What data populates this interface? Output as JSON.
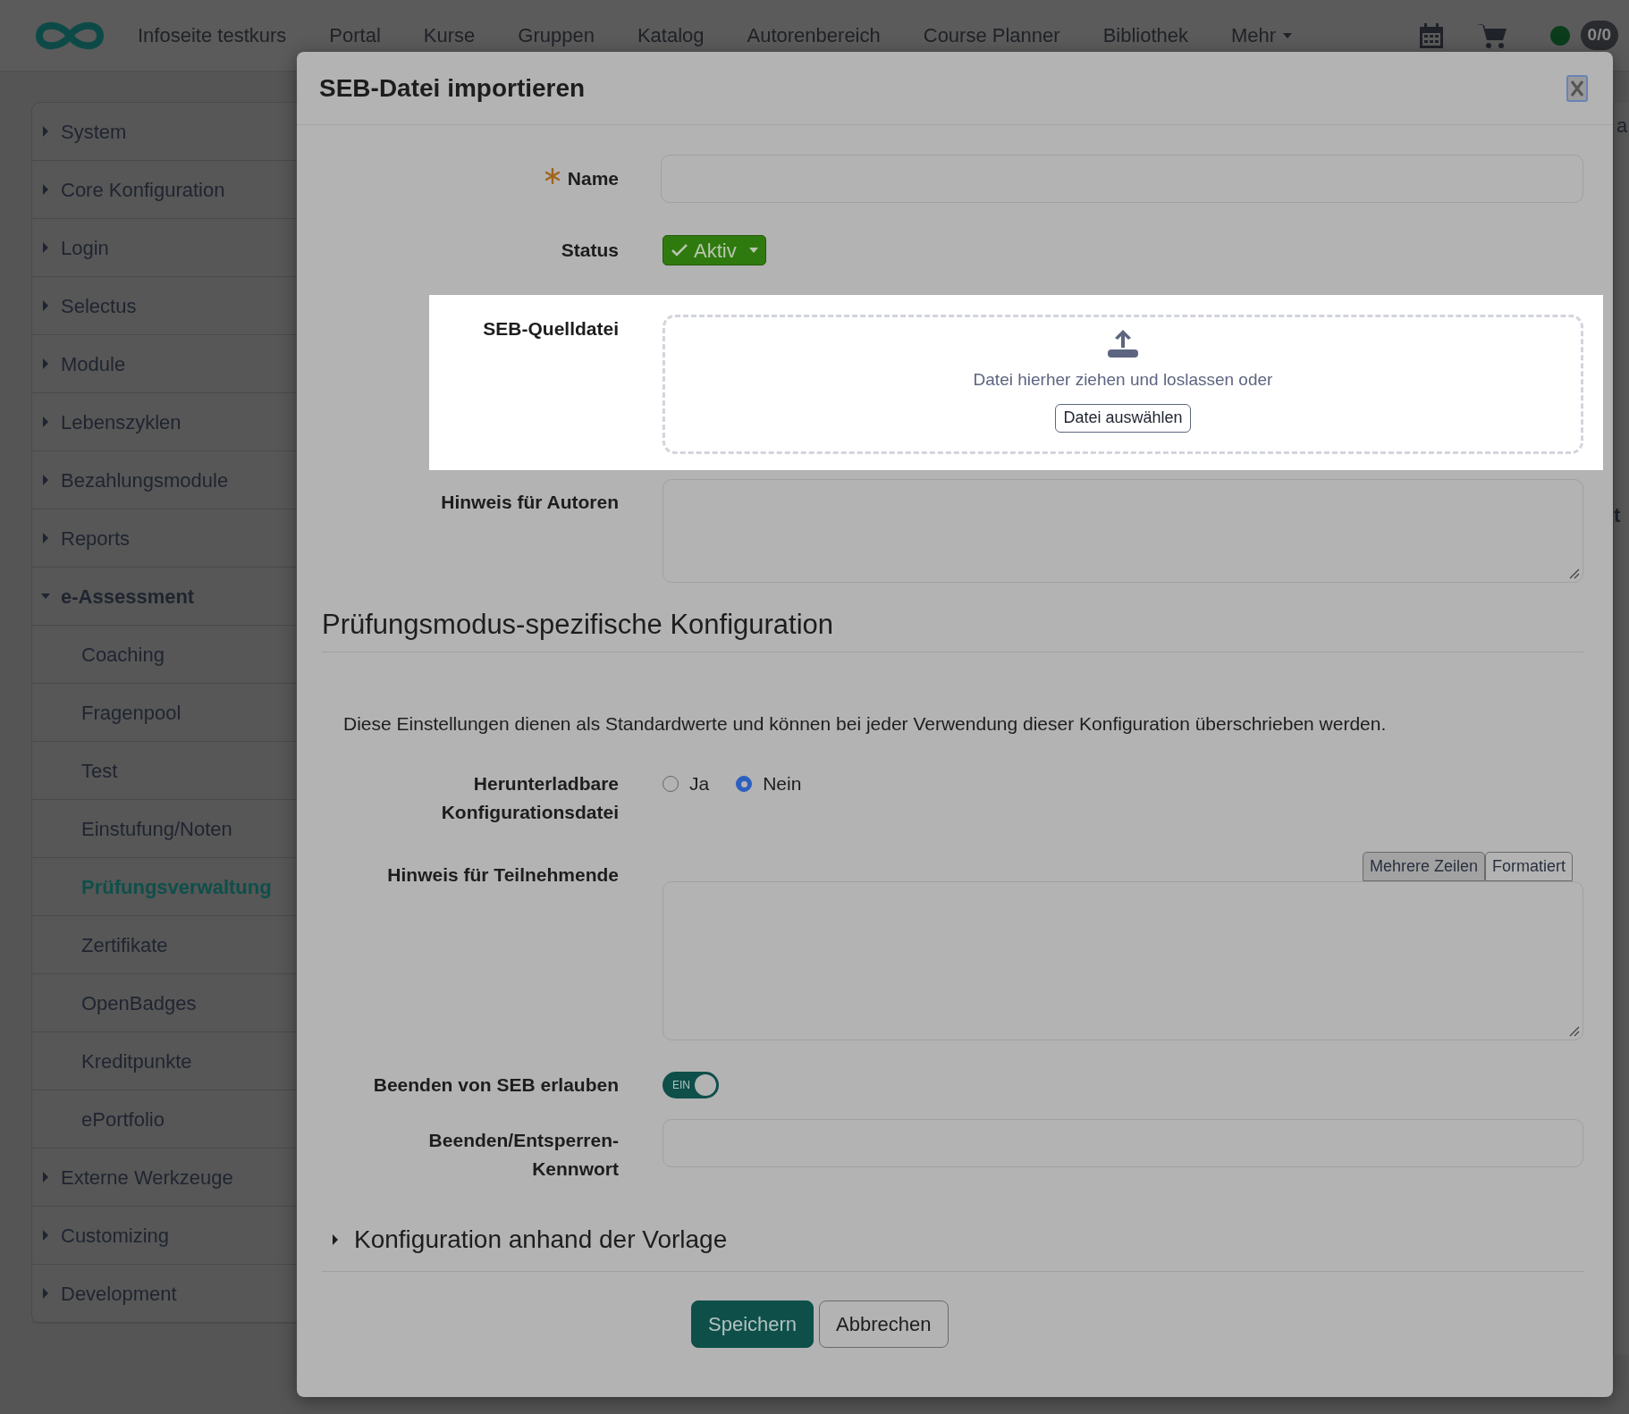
{
  "topbar": {
    "nav_items": [
      {
        "label": "Infoseite testkurs"
      },
      {
        "label": "Portal"
      },
      {
        "label": "Kurse"
      },
      {
        "label": "Gruppen"
      },
      {
        "label": "Katalog"
      },
      {
        "label": "Autorenbereich"
      },
      {
        "label": "Course Planner"
      },
      {
        "label": "Bibliothek"
      }
    ],
    "more": {
      "label": "Mehr"
    },
    "status_dot": {
      "color": "#0b3d1c"
    },
    "counter": "0/0"
  },
  "sidebar": {
    "items": [
      {
        "label": "System",
        "expanded": false,
        "selected": false
      },
      {
        "label": "Core Konfiguration",
        "expanded": false,
        "selected": false
      },
      {
        "label": "Login",
        "expanded": false,
        "selected": false
      },
      {
        "label": "Selectus",
        "expanded": false,
        "selected": false
      },
      {
        "label": "Module",
        "expanded": false,
        "selected": false
      },
      {
        "label": "Lebenszyklen",
        "expanded": false,
        "selected": false
      },
      {
        "label": "Bezahlungsmodule",
        "expanded": false,
        "selected": false
      },
      {
        "label": "Reports",
        "expanded": false,
        "selected": false
      },
      {
        "label": "e-Assessment",
        "expanded": true,
        "selected": false,
        "children": [
          {
            "label": "Coaching",
            "selected": false
          },
          {
            "label": "Fragenpool",
            "selected": false
          },
          {
            "label": "Test",
            "selected": false
          },
          {
            "label": "Einstufung/Noten",
            "selected": false
          },
          {
            "label": "Prüfungsverwaltung",
            "selected": true
          },
          {
            "label": "Zertifikate",
            "selected": false
          },
          {
            "label": "OpenBadges",
            "selected": false
          },
          {
            "label": "Kreditpunkte",
            "selected": false
          },
          {
            "label": "ePortfolio",
            "selected": false
          }
        ]
      },
      {
        "label": "Externe Werkzeuge",
        "expanded": false,
        "selected": false
      },
      {
        "label": "Customizing",
        "expanded": false,
        "selected": false
      },
      {
        "label": "Development",
        "expanded": false,
        "selected": false
      }
    ]
  },
  "background_fragments": [
    "a",
    "t"
  ],
  "modal": {
    "title": "SEB-Datei importieren",
    "name": {
      "label": "Name",
      "required": true
    },
    "status": {
      "label": "Status",
      "value": "Aktiv"
    },
    "source_file": {
      "label": "SEB-Quelldatei",
      "hint": "Datei hierher ziehen und loslassen oder",
      "button": "Datei auswählen",
      "highlighted": true
    },
    "author_note": {
      "label": "Hinweis für Autoren"
    },
    "section": {
      "title": "Prüfungsmodus-spezifische Konfiguration",
      "description": "Diese Einstellungen dienen als Standardwerte und können bei jeder Verwendung dieser Konfiguration überschrieben werden."
    },
    "downloadable": {
      "label": "Herunterladbare Konfigurationsdatei",
      "options": [
        {
          "label": "Ja",
          "selected": false
        },
        {
          "label": "Nein",
          "selected": true
        }
      ]
    },
    "participant_note": {
      "label": "Hinweis für Teilnehmende",
      "tabs": [
        {
          "label": "Mehrere Zeilen",
          "selected": true
        },
        {
          "label": "Formatiert",
          "selected": false
        }
      ]
    },
    "quit_allowed": {
      "label": "Beenden von SEB erlauben",
      "on": true,
      "on_text": "EIN"
    },
    "quit_password": {
      "label": "Beenden/Entsperren-Kennwort"
    },
    "template": {
      "label": "Konfiguration anhand der Vorlage",
      "expanded": false
    },
    "buttons": [
      {
        "label": "Speichern",
        "kind": "primary"
      },
      {
        "label": "Abbrechen",
        "kind": "secondary"
      }
    ]
  }
}
